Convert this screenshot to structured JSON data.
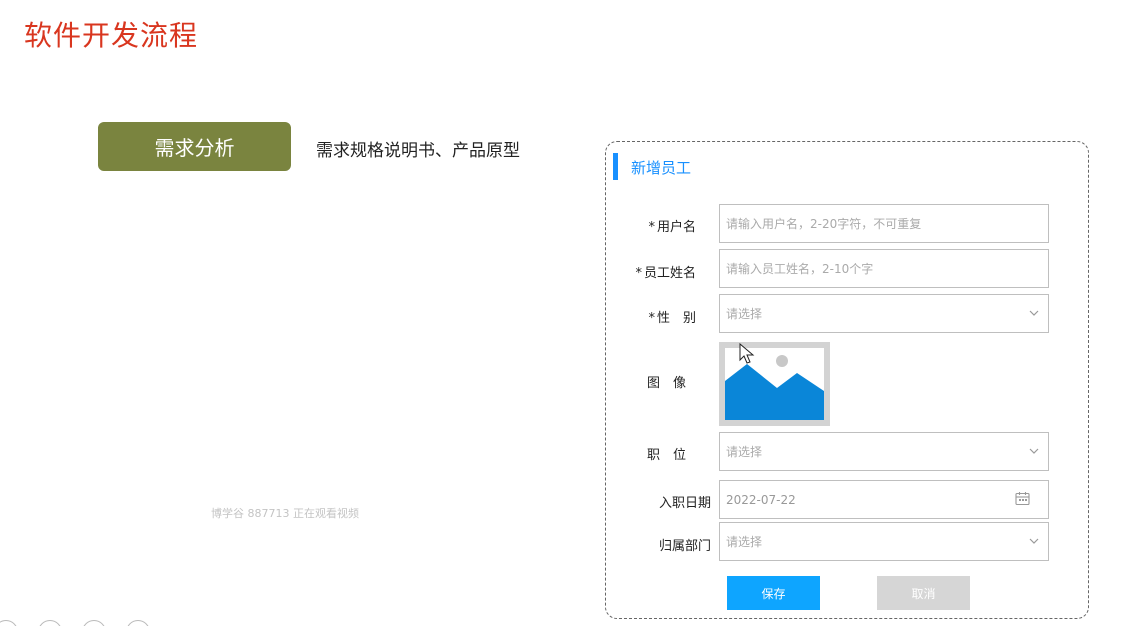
{
  "page": {
    "title": "软件开发流程"
  },
  "step": {
    "label": "需求分析",
    "description": "需求规格说明书、产品原型"
  },
  "watermark": "博学谷 887713 正在观看视频",
  "form": {
    "title": "新增员工",
    "fields": [
      {
        "label": "用户名",
        "required": true,
        "type": "text",
        "placeholder": "请输入用户名，2-20字符，不可重复"
      },
      {
        "label": "员工姓名",
        "required": true,
        "type": "text",
        "placeholder": "请输入员工姓名，2-10个字"
      },
      {
        "label": "性　别",
        "required": true,
        "type": "select",
        "placeholder": "请选择"
      },
      {
        "label": "图　像",
        "required": false,
        "type": "image"
      },
      {
        "label": "职　位",
        "required": false,
        "type": "select",
        "placeholder": "请选择"
      },
      {
        "label": "入职日期",
        "required": false,
        "type": "date",
        "value": "2022-07-22"
      },
      {
        "label": "归属部门",
        "required": false,
        "type": "select",
        "placeholder": "请选择"
      }
    ],
    "save_label": "保存",
    "cancel_label": "取消",
    "required_mark": "*"
  },
  "colors": {
    "title": "#d9361f",
    "badge": "#7a843f",
    "accent": "#1890ff",
    "save": "#0ea5ff",
    "cancel": "#d6d6d6",
    "image": "#0a86d8"
  },
  "icons": {
    "select": "chevron-down-icon",
    "date": "calendar-icon",
    "image": "image-placeholder-icon",
    "cursor": "mouse-cursor-icon"
  }
}
